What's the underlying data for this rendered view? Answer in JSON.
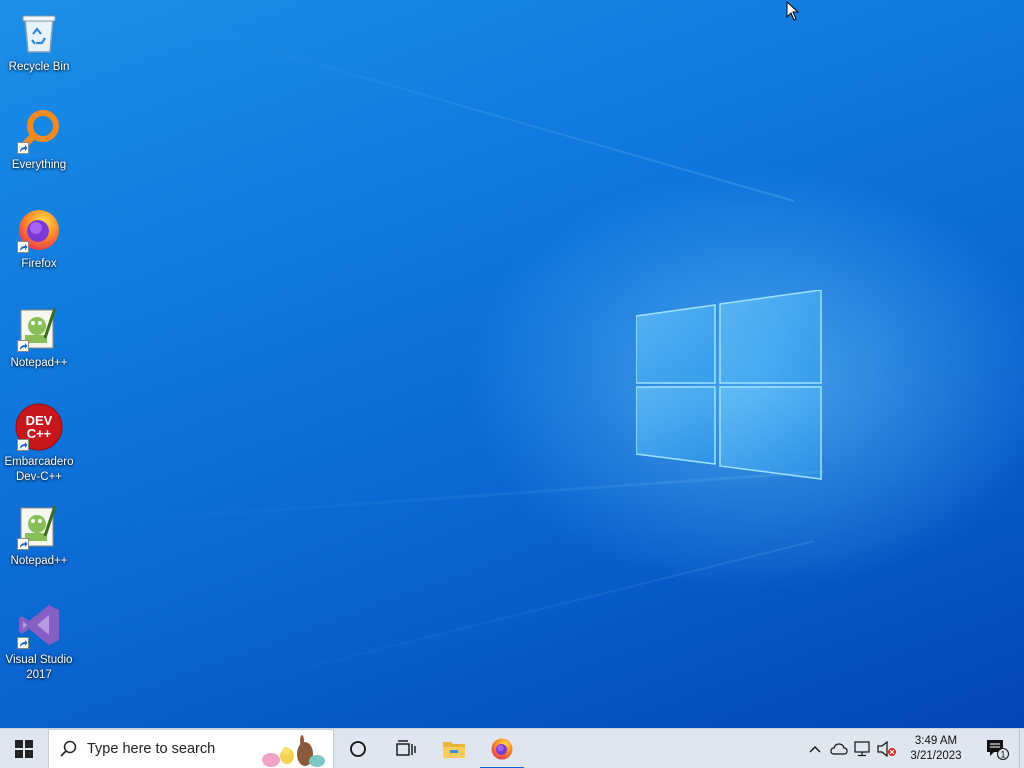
{
  "desktop": {
    "icons": [
      {
        "label": "Recycle Bin",
        "icon": "recycle-bin-icon"
      },
      {
        "label": "Everything",
        "icon": "everything-search-icon"
      },
      {
        "label": "Firefox",
        "icon": "firefox-icon"
      },
      {
        "label": "Notepad++",
        "icon": "notepad-plus-plus-icon"
      },
      {
        "label": "Embarcadero Dev-C++",
        "icon": "dev-cpp-icon",
        "badge": "DEV C++"
      },
      {
        "label": "Notepad++",
        "icon": "notepad-plus-plus-icon"
      },
      {
        "label": "Visual Studio 2017",
        "icon": "visual-studio-icon"
      }
    ]
  },
  "taskbar": {
    "search_placeholder": "Type here to search",
    "pinned": [
      {
        "name": "cortana-icon"
      },
      {
        "name": "task-view-icon"
      },
      {
        "name": "file-explorer-icon"
      },
      {
        "name": "firefox-icon",
        "active": true
      }
    ],
    "tray": {
      "clock_time": "3:49 AM",
      "clock_date": "3/21/2023",
      "notification_count": "1"
    }
  },
  "colors": {
    "accent": "#0a6ad6",
    "taskbar": "#dfe6ef"
  }
}
